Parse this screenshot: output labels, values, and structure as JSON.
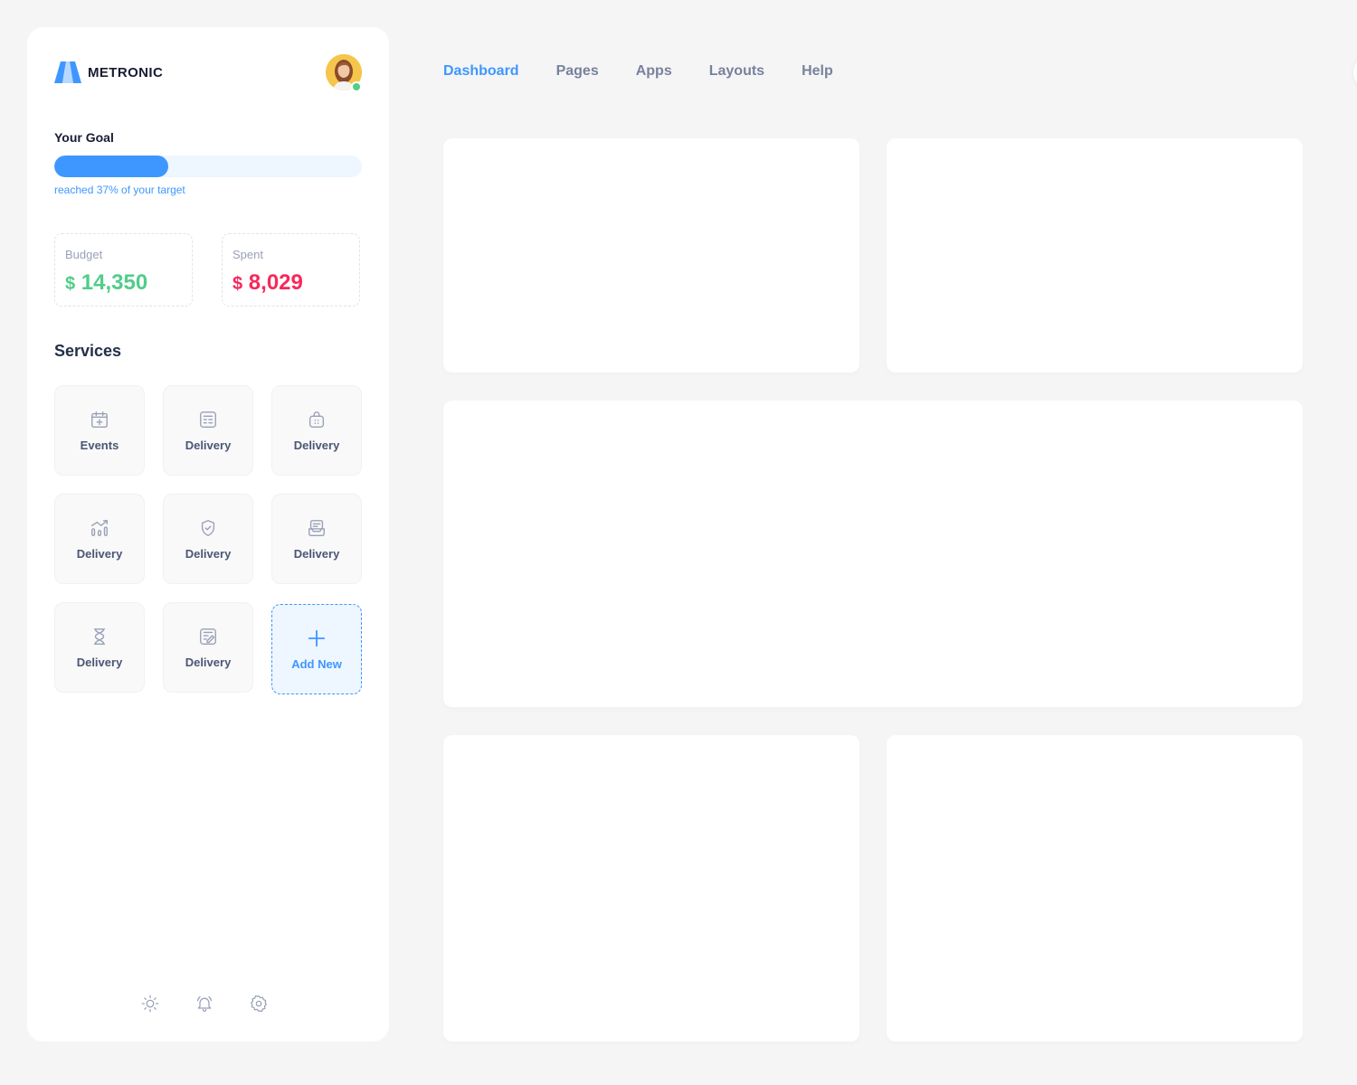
{
  "brand": {
    "name": "METRONIC",
    "accent": "#3e97ff"
  },
  "goal": {
    "title": "Your Goal",
    "progress_percent": 37,
    "subtitle": "reached 37% of your target"
  },
  "stats": {
    "budget": {
      "label": "Budget",
      "currency": "$",
      "amount": "14,350",
      "color": "#50cd89"
    },
    "spent": {
      "label": "Spent",
      "currency": "$",
      "amount": "8,029",
      "color": "#f8285a"
    }
  },
  "services": {
    "title": "Services",
    "items": [
      {
        "label": "Events",
        "icon": "calendar-add-icon"
      },
      {
        "label": "Delivery",
        "icon": "document-list-icon"
      },
      {
        "label": "Delivery",
        "icon": "shopping-bag-icon"
      },
      {
        "label": "Delivery",
        "icon": "chart-growth-icon"
      },
      {
        "label": "Delivery",
        "icon": "shield-check-icon"
      },
      {
        "label": "Delivery",
        "icon": "mail-tray-icon"
      },
      {
        "label": "Delivery",
        "icon": "hourglass-icon"
      },
      {
        "label": "Delivery",
        "icon": "edit-document-icon"
      }
    ],
    "add_label": "Add New"
  },
  "footer_icons": [
    "sun-icon",
    "bell-icon",
    "gear-icon"
  ],
  "nav": {
    "items": [
      {
        "label": "Dashboard",
        "active": true
      },
      {
        "label": "Pages",
        "active": false
      },
      {
        "label": "Apps",
        "active": false
      },
      {
        "label": "Layouts",
        "active": false
      },
      {
        "label": "Help",
        "active": false
      }
    ]
  }
}
